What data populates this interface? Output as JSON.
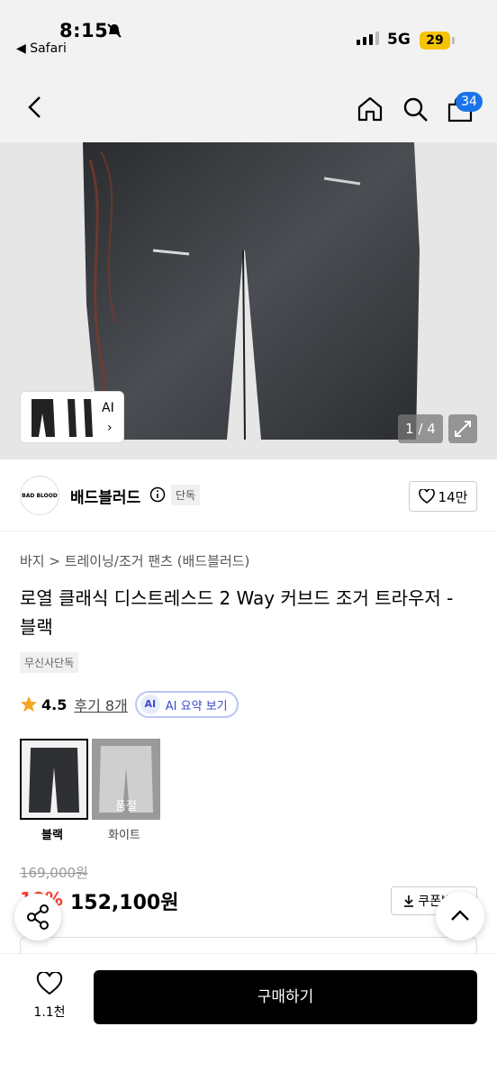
{
  "status_bar": {
    "time": "8:15",
    "back_app": "◀ Safari",
    "network": "5G",
    "battery": "29"
  },
  "nav": {
    "cart_count": "34"
  },
  "gallery": {
    "ai_label": "AI",
    "counter": "1 / 4"
  },
  "brand": {
    "logo_text": "BAD BLOOD",
    "name": "배드블러드",
    "tag": "단독",
    "likes": "14만"
  },
  "product": {
    "breadcrumb": "바지 > 트레이닝/조거 팬츠 (배드블러드)",
    "title": "로열 클래식 디스트레스드 2 Way 커브드 조거 트라우저 - 블랙",
    "exclusive_tag": "무신사단독",
    "rating": "4.5",
    "reviews": "후기 8개",
    "ai_summary": "AI 요약 보기",
    "ai_badge": "AI"
  },
  "options": [
    {
      "label": "블랙",
      "sold_out": ""
    },
    {
      "label": "화이트",
      "sold_out": "품절"
    }
  ],
  "price": {
    "original": "169,000원",
    "discount": "10%",
    "sale": "152,100원",
    "coupon": "쿠폰받기"
  },
  "bottom": {
    "wish_count": "1.1천",
    "buy_label": "구매하기"
  }
}
